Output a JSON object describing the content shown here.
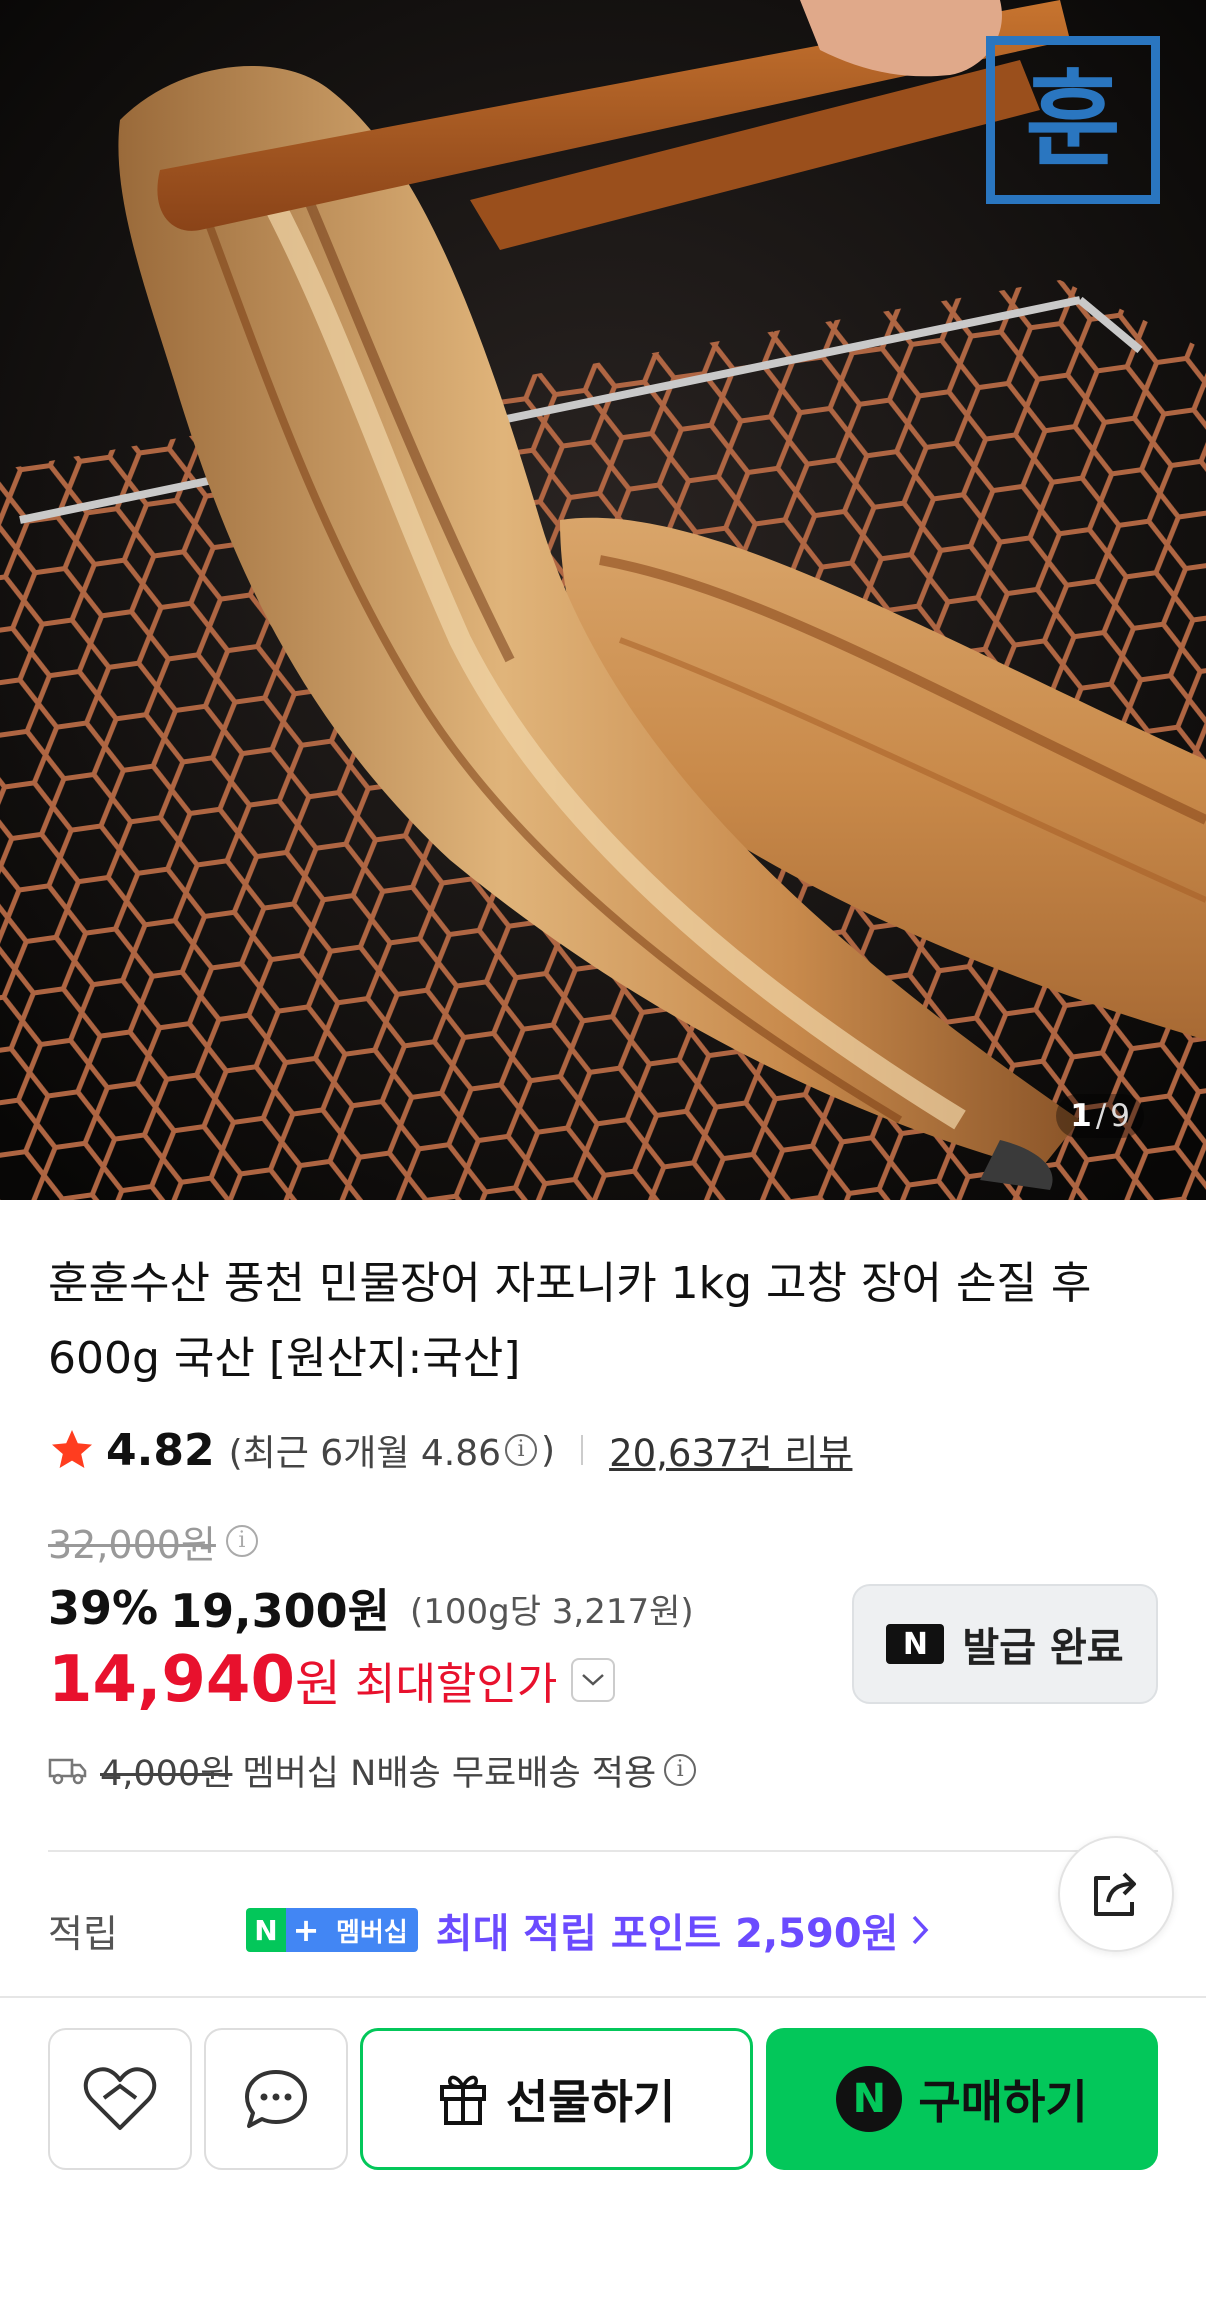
{
  "gallery": {
    "current": "1",
    "separator": "/",
    "total": "9",
    "logo_text": "훈"
  },
  "product": {
    "title": "훈훈수산 풍천 민물장어 자포니카 1kg 고창 장어 손질 후 600g 국산 [원산지:국산]"
  },
  "rating": {
    "value": "4.82",
    "recent": "(최근 6개월 4.86",
    "recent_close": ")",
    "reviews": "20,637건 리뷰"
  },
  "price": {
    "original": "32,000원",
    "discount_pct": "39%",
    "sale": "19,300원",
    "unit": "(100g당 3,217원)",
    "max": "14,940",
    "max_unit": "원",
    "max_label": "최대할인가"
  },
  "coupon": {
    "badge": "N",
    "label": "발급 완료"
  },
  "shipping": {
    "original_fee": "4,000원",
    "text": "멤버십 N배송 무료배송 적용"
  },
  "points": {
    "label": "적립",
    "badge_n": "N",
    "badge_plus": "+",
    "badge_text": "멤버십",
    "text": "최대 적립 포인트 2,590원"
  },
  "actions": {
    "gift": "선물하기",
    "buy_badge": "N",
    "buy": "구매하기"
  },
  "colors": {
    "accent_green": "#03c75a",
    "price_red": "#e8112d",
    "points_purple": "#6b4bff",
    "star": "#ff3d1f"
  }
}
